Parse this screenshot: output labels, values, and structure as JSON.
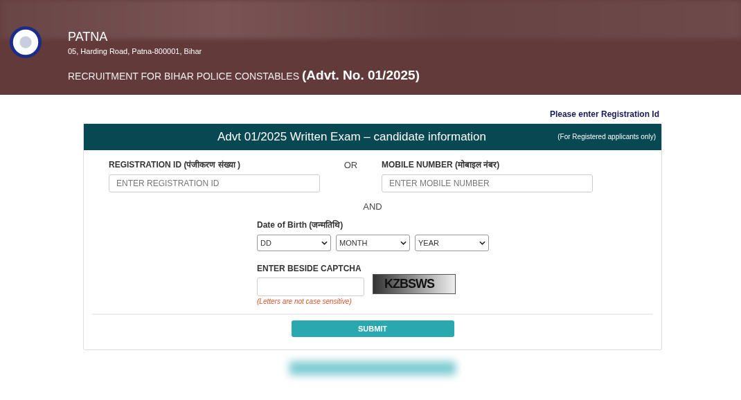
{
  "header": {
    "org": "PATNA",
    "address": "05, Harding Road, Patna-800001, Bihar",
    "recruitment": "RECRUITMENT FOR BIHAR POLICE CONSTABLES",
    "advt": "(Advt. No. 01/2025)"
  },
  "hint": "Please enter Registration Id",
  "panel": {
    "title": "Advt 01/2025 Written Exam – candidate information",
    "note": "(For Registered applicants only)",
    "registration": {
      "label": "REGISTRATION ID (पंजीकरण संख्या )",
      "placeholder": "ENTER REGISTRATION ID"
    },
    "or": "OR",
    "mobile": {
      "label": "MOBILE NUMBER (मोबाइल नंबर)",
      "placeholder": "ENTER MOBILE NUMBER"
    },
    "and": "AND",
    "dob": {
      "label": "Date of Birth (जन्मतिथि)",
      "selects": [
        {
          "value": "DD"
        },
        {
          "value": "MONTH"
        },
        {
          "value": "YEAR"
        }
      ]
    },
    "captcha": {
      "label": "ENTER BESIDE CAPTCHA",
      "code": "KZBSWS",
      "note": "(Letters are not case sensitive)"
    },
    "submit": "SUBMIT"
  }
}
